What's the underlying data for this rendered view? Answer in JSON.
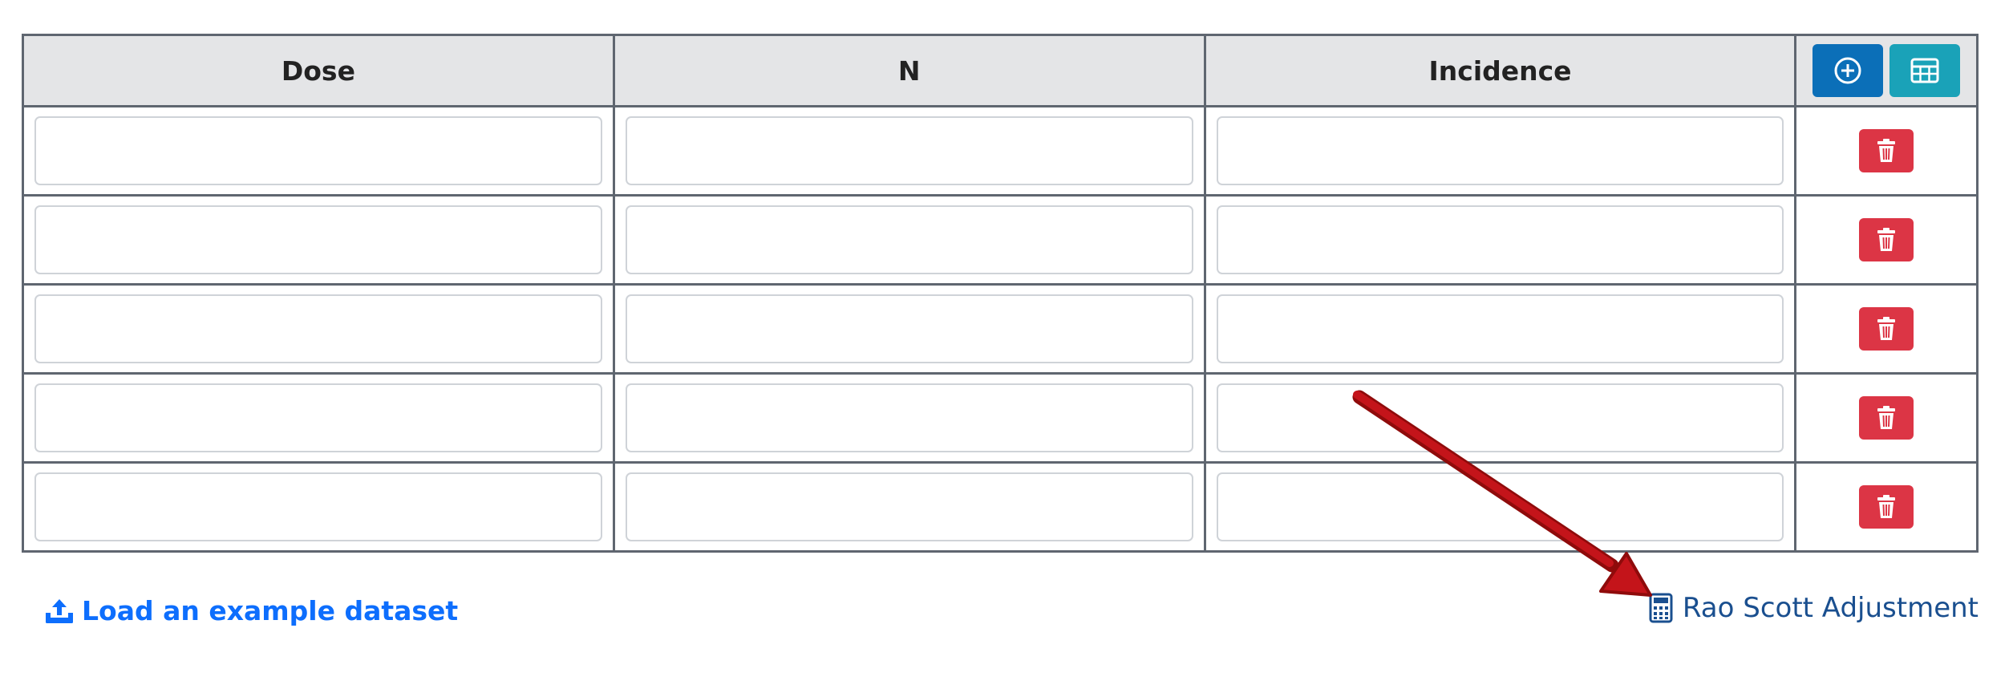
{
  "table": {
    "headers": [
      "Dose",
      "N",
      "Incidence"
    ],
    "rows": [
      {
        "dose": "",
        "n": "",
        "incidence": ""
      },
      {
        "dose": "",
        "n": "",
        "incidence": ""
      },
      {
        "dose": "",
        "n": "",
        "incidence": ""
      },
      {
        "dose": "",
        "n": "",
        "incidence": ""
      },
      {
        "dose": "",
        "n": "",
        "incidence": ""
      }
    ],
    "add_row_icon": "plus-circle-icon",
    "table_icon": "table-icon",
    "delete_icon": "trash-icon"
  },
  "links": {
    "load_example": "Load an example dataset",
    "load_example_icon": "upload-icon",
    "rao_scott": "Rao Scott Adjustment",
    "rao_scott_icon": "calculator-icon"
  },
  "annotation": {
    "arrow_icon": "red-arrow-icon",
    "arrow_color": "#b50c0c"
  },
  "colors": {
    "primary": "#0b6fb8",
    "info": "#1aa2b8",
    "danger": "#dc3545",
    "link": "#0d6efd",
    "link_dark": "#1a4f8f",
    "header_bg": "#e4e5e7"
  }
}
